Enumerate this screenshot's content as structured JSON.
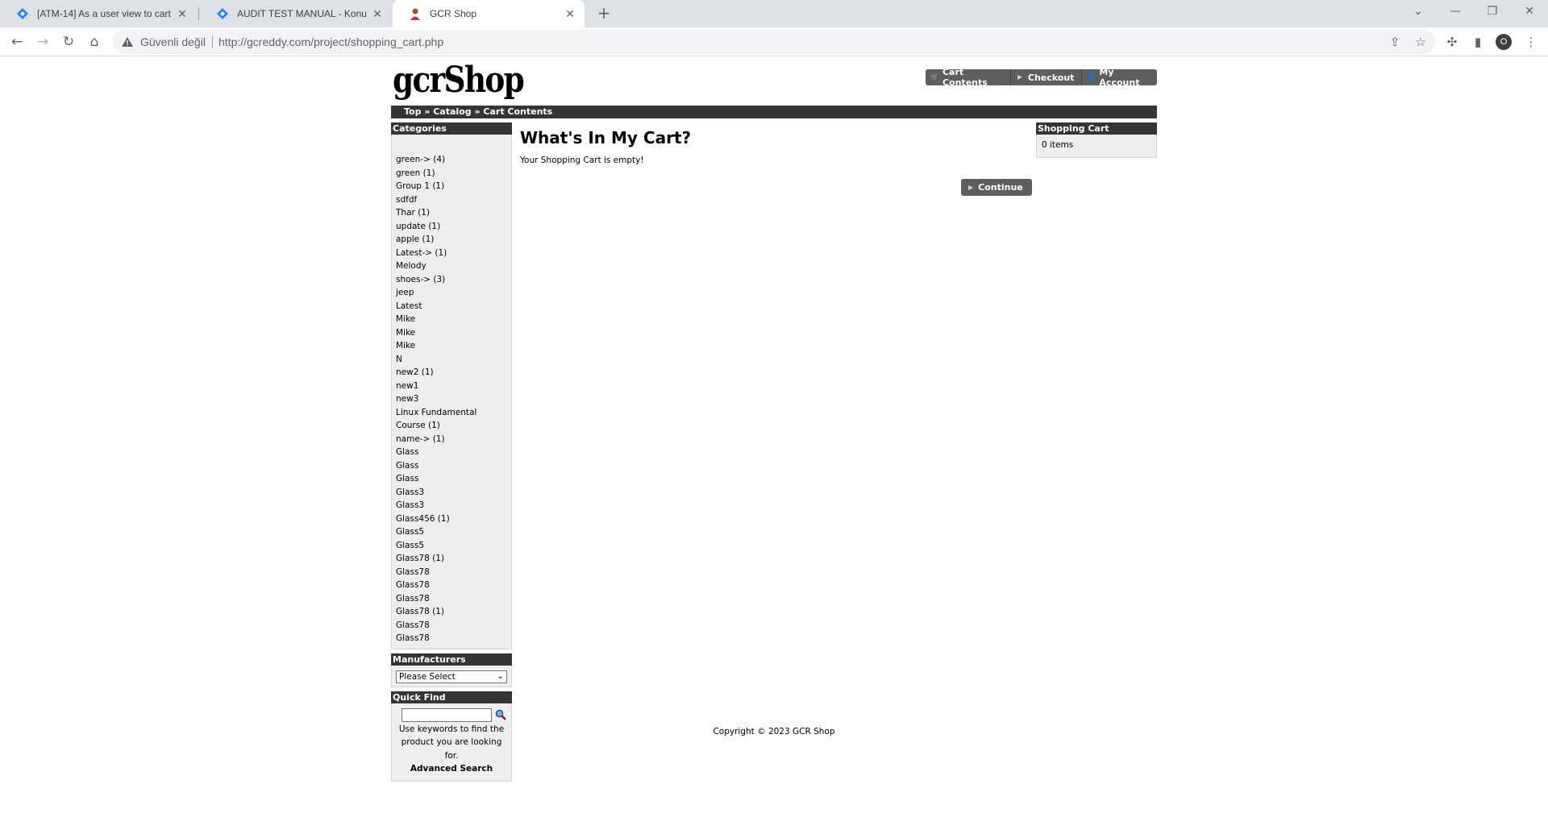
{
  "browser": {
    "tabs": [
      {
        "title": "[ATM-14] As a user view to cart c",
        "icon": "jira-diamond-icon"
      },
      {
        "title": "AUDIT TEST MANUAL - Konular -",
        "icon": "jira-diamond-icon"
      },
      {
        "title": "GCR Shop",
        "icon": "avatar-favicon"
      }
    ],
    "insecure_label": "Güvenli değil",
    "url": "http://gcreddy.com/project/shopping_cart.php",
    "profile_initial": "O"
  },
  "header": {
    "logo": "gcrShop",
    "buttons": [
      {
        "label": "Cart Contents",
        "icon": "cart-icon"
      },
      {
        "label": "Checkout",
        "icon": "triangle-right-icon"
      },
      {
        "label": "My Account",
        "icon": "person-icon"
      }
    ]
  },
  "breadcrumb": {
    "top": "Top",
    "sep": " » ",
    "catalog": "Catalog",
    "current": "Cart Contents"
  },
  "categories": {
    "title": "Categories",
    "items": [
      "green-> (4)",
      "green (1)",
      "Group 1 (1)",
      "sdfdf",
      "Thar (1)",
      "update (1)",
      "apple (1)",
      "Latest-> (1)",
      "Melody",
      "shoes-> (3)",
      "jeep",
      "Latest",
      "Mike",
      "Mike",
      "Mike",
      "N",
      "new2 (1)",
      "new1",
      "new3",
      "Linux Fundamental",
      "Course (1)",
      "name-> (1)",
      "Glass",
      "Glass",
      "Glass",
      "Glass3",
      "Glass3",
      "Glass456 (1)",
      "Glass5",
      "Glass5",
      "Glass78 (1)",
      "Glass78",
      "Glass78",
      "Glass78",
      "Glass78 (1)",
      "Glass78",
      "Glass78"
    ]
  },
  "manufacturers": {
    "title": "Manufacturers",
    "selected": "Please Select"
  },
  "quick_find": {
    "title": "Quick Find",
    "help": "Use keywords to find the product you are looking for.",
    "advanced": "Advanced Search"
  },
  "main": {
    "title": "What's In My Cart?",
    "empty_text": "Your Shopping Cart is empty!",
    "continue_label": "Continue"
  },
  "shopping_cart": {
    "title": "Shopping Cart",
    "items_text": "0 items"
  },
  "footer": {
    "copyright": "Copyright © 2023 GCR Shop"
  }
}
